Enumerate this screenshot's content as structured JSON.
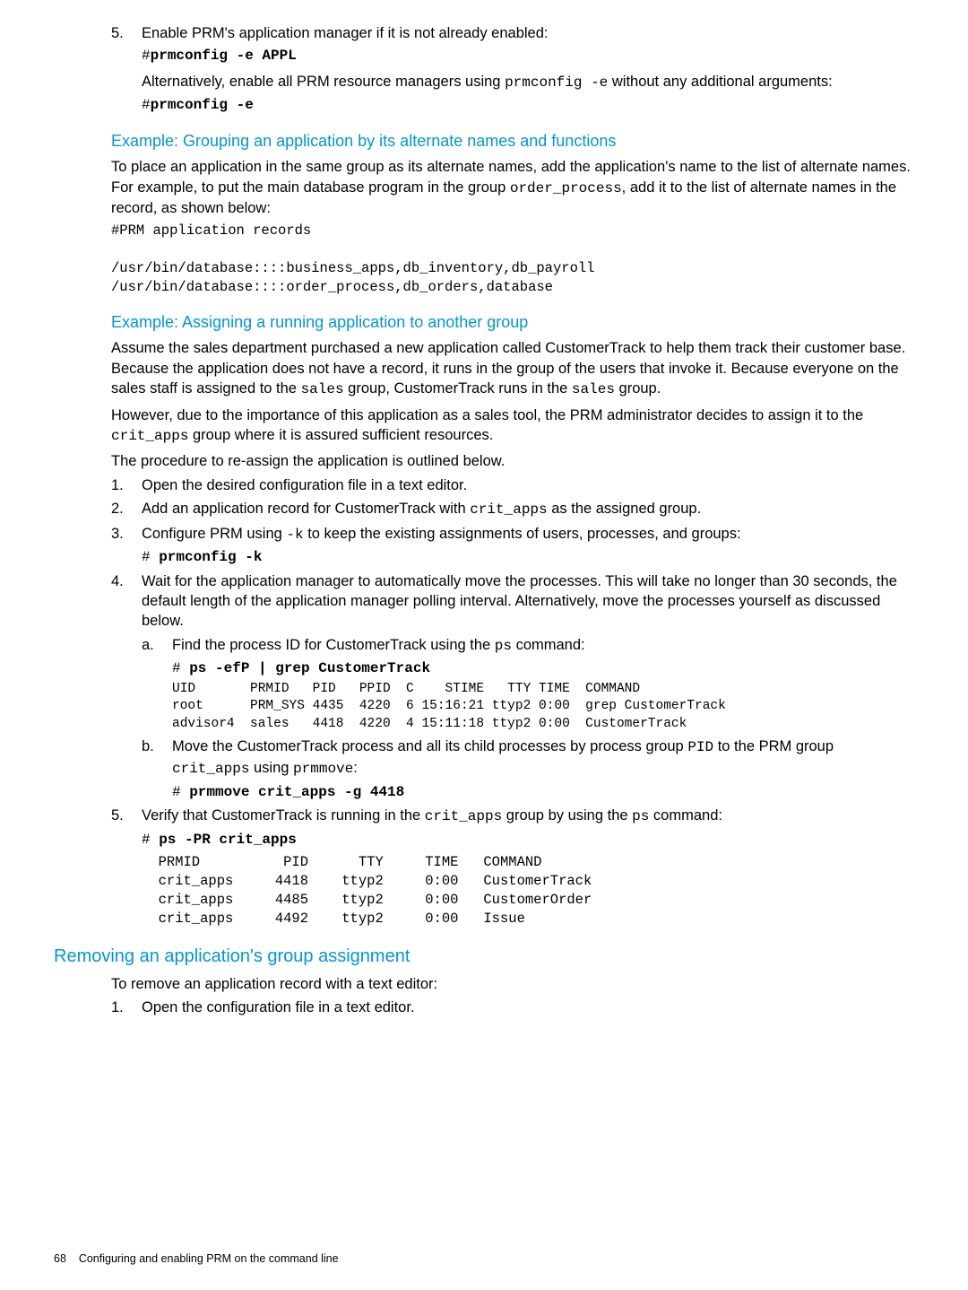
{
  "step5": {
    "num": "5.",
    "text_pre": "Enable PRM's application manager if it is not already enabled:",
    "cmd1": "#prmconfig -e APPL",
    "alt_pre": "Alternatively, enable all PRM resource managers using ",
    "alt_mono": "prmconfig -e",
    "alt_post": " without any additional arguments:",
    "cmd2": "#prmconfig -e"
  },
  "example1": {
    "heading": "Example: Grouping an application by its alternate names and functions",
    "p1_pre": "To place an application in the same group as its alternate names, add the application's name to the list of alternate names. For example, to put the main database program in the group ",
    "p1_mono": "order_process",
    "p1_post": ", add it to the list of alternate names in the record, as shown below:",
    "code": "#PRM application records\n\n/usr/bin/database::::business_apps,db_inventory,db_payroll\n/usr/bin/database::::order_process,db_orders,database"
  },
  "example2": {
    "heading": "Example: Assigning a running application to another group",
    "p1_pre": "Assume the sales department purchased a new application called CustomerTrack to help them track their customer base. Because the application does not have a record, it runs in the group of the users that invoke it. Because everyone on the sales staff is assigned to the ",
    "p1_mono1": "sales",
    "p1_mid": " group, CustomerTrack runs in the ",
    "p1_mono2": "sales",
    "p1_post": " group.",
    "p2_pre": "However, due to the importance of this application as a sales tool, the PRM administrator decides to assign it to the ",
    "p2_mono": "crit_apps",
    "p2_post": " group where it is assured sufficient resources.",
    "p3": "The procedure to re-assign the application is outlined below.",
    "s1": {
      "num": "1.",
      "text": "Open the desired configuration file in a text editor."
    },
    "s2": {
      "num": "2.",
      "pre": "Add an application record for CustomerTrack with ",
      "mono": "crit_apps",
      "post": " as the assigned group."
    },
    "s3": {
      "num": "3.",
      "pre": "Configure PRM using ",
      "mono": "-k",
      "post": " to keep the existing assignments of users, processes, and groups:",
      "cmd_prefix": "# ",
      "cmd_bold": "prmconfig -k"
    },
    "s4": {
      "num": "4.",
      "text": "Wait for the application manager to automatically move the processes. This will take no longer than 30 seconds, the default length of the application manager polling interval. Alternatively, move the processes yourself as discussed below.",
      "a": {
        "num": "a.",
        "pre": "Find the process ID for CustomerTrack using the ",
        "mono": "ps",
        "post": " command:",
        "cmd_prefix": "# ",
        "cmd_bold": "ps -efP | grep CustomerTrack",
        "out": "UID       PRMID   PID   PPID  C    STIME   TTY TIME  COMMAND\nroot      PRM_SYS 4435  4220  6 15:16:21 ttyp2 0:00  grep CustomerTrack\nadvisor4  sales   4418  4220  4 15:11:18 ttyp2 0:00  CustomerTrack"
      },
      "b": {
        "num": "b.",
        "pre": "Move the CustomerTrack process and all its child processes by process group ",
        "mono1": "PID",
        "mid": " to the PRM group ",
        "mono2": "crit_apps",
        "mid2": " using ",
        "mono3": "prmmove",
        "post": ":",
        "cmd_prefix": "# ",
        "cmd_bold": "prmmove crit_apps -g 4418"
      }
    },
    "s5": {
      "num": "5.",
      "pre": "Verify that CustomerTrack is running in the ",
      "mono1": "crit_apps",
      "mid": " group by using the ",
      "mono2": "ps",
      "post": " command:",
      "cmd_prefix": "# ",
      "cmd_bold": "ps -PR crit_apps",
      "out": "  PRMID          PID      TTY     TIME   COMMAND\n  crit_apps     4418    ttyp2     0:00   CustomerTrack\n  crit_apps     4485    ttyp2     0:00   CustomerOrder\n  crit_apps     4492    ttyp2     0:00   Issue"
    }
  },
  "removing": {
    "heading": "Removing an application's group assignment",
    "p1": "To remove an application record with a text editor:",
    "s1": {
      "num": "1.",
      "text": "Open the configuration file in a text editor."
    }
  },
  "footer": {
    "page": "68",
    "title": "Configuring and enabling PRM on the command line"
  }
}
